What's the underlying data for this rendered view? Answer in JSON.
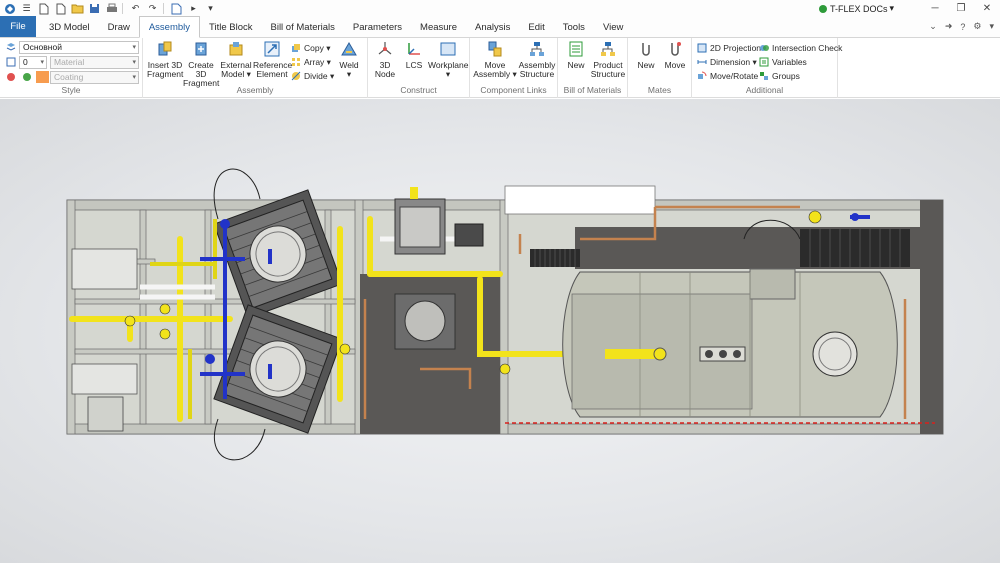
{
  "app": {
    "brand": "T-FLEX DOCs",
    "brand_caret": "▾"
  },
  "qat": {
    "icons": [
      "tflex-logo-icon",
      "menu-icon",
      "new-document-icon",
      "open-icon",
      "save-icon",
      "print-icon",
      "undo-icon",
      "redo-icon",
      "export-icon",
      "play-icon",
      "customize-icon"
    ]
  },
  "tabs": [
    {
      "label": "File"
    },
    {
      "label": "3D Model"
    },
    {
      "label": "Draw"
    },
    {
      "label": "Assembly"
    },
    {
      "label": "Title Block"
    },
    {
      "label": "Bill of Materials"
    },
    {
      "label": "Parameters"
    },
    {
      "label": "Measure"
    },
    {
      "label": "Analysis"
    },
    {
      "label": "Edit"
    },
    {
      "label": "Tools"
    },
    {
      "label": "View"
    }
  ],
  "style_group": {
    "layer_value": "Основной",
    "level_value": "0",
    "material_placeholder": "Material",
    "coating_placeholder": "Coating",
    "label": "Style"
  },
  "assembly_group": {
    "insert_3d_fragment": "Insert 3D\nFragment",
    "insert_3d_fragment_l1": "Insert 3D",
    "insert_3d_fragment_l2": "Fragment",
    "create_3d_fragment_l1": "Create 3D",
    "create_3d_fragment_l2": "Fragment",
    "external_model_l1": "External",
    "external_model_l2": "Model ▾",
    "reference_element_l1": "Reference",
    "reference_element_l2": "Element",
    "copy": "Copy ▾",
    "array": "Array ▾",
    "divide": "Divide ▾",
    "weld": "Weld",
    "weld_caret": "▾",
    "label": "Assembly"
  },
  "construct_group": {
    "node_l1": "3D",
    "node_l2": "Node",
    "lcs": "LCS",
    "workplane": "Workplane",
    "workplane_caret": "▾",
    "label": "Construct"
  },
  "component_links_group": {
    "move_assembly_l1": "Move",
    "move_assembly_l2": "Assembly ▾",
    "assembly_structure_l1": "Assembly",
    "assembly_structure_l2": "Structure",
    "label": "Component Links"
  },
  "bom_group": {
    "new": "New",
    "product_structure_l1": "Product",
    "product_structure_l2": "Structure",
    "label": "Bill of Materials"
  },
  "mates_group": {
    "new": "New",
    "move": "Move",
    "label": "Mates"
  },
  "additional_group": {
    "projection_2d": "2D Projection",
    "dimension": "Dimension ▾",
    "move_rotate": "Move/Rotate",
    "intersection_check": "Intersection Check",
    "variables": "Variables",
    "groups": "Groups",
    "label": "Additional"
  },
  "colors": {
    "file_tab": "#2c6fb4",
    "accent": "#1e5a9c",
    "pipe_yellow": "#f2e31b",
    "pipe_blue": "#2233c8",
    "frame": "#c9cbc4",
    "tank": "#c5c7ba",
    "copper": "#c4824e"
  }
}
